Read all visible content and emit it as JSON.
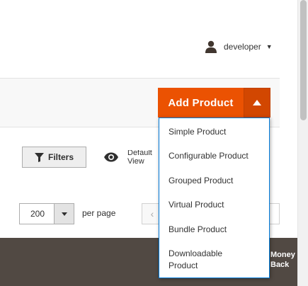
{
  "header": {
    "user": {
      "name": "developer",
      "icon": "user-icon"
    }
  },
  "page_actions": {
    "add_product_label": "Add Product",
    "toggle_icon": "triangle-up-icon",
    "colors": {
      "primary": "#eb5202",
      "primary_dark": "#d24701",
      "dropdown_border": "#007bdb"
    }
  },
  "product_type_menu": {
    "items": [
      "Simple Product",
      "Configurable Product",
      "Grouped Product",
      "Virtual Product",
      "Bundle Product",
      "Downloadable Product"
    ]
  },
  "toolbar": {
    "filters_label": "Filters",
    "filters_icon": "funnel-icon",
    "view_label": "Default View",
    "view_icon": "eye-icon",
    "per_page_value": "200",
    "per_page_label": "per page",
    "prev_icon": "chevron-left-icon"
  },
  "grid": {
    "header_color": "#514943",
    "visible_column": "Money Back"
  }
}
